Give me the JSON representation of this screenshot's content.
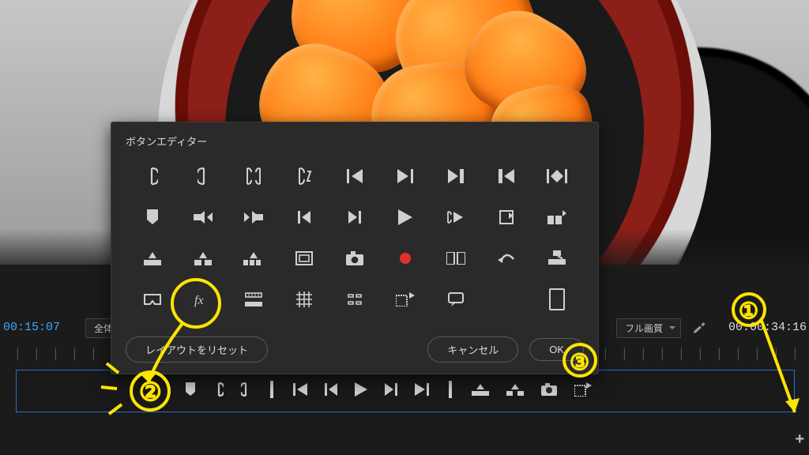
{
  "time": {
    "in": "00:15:07",
    "out": "00:00:34:16"
  },
  "viewer": {
    "fit_label": "全体",
    "quality_label": "フル画質"
  },
  "popover": {
    "title": "ボタンエディター",
    "buttons": {
      "reset": "レイアウトをリセット",
      "cancel": "キャンセル",
      "ok": "OK"
    },
    "grid": [
      [
        "mark-in",
        "mark-out",
        "in-out",
        "go-to",
        "go-to-in",
        "go-to-out",
        "go-to-next",
        "go-to-prev",
        "in-out-jump"
      ],
      [
        "insert",
        "next-edit",
        "prev-edit",
        "step-back",
        "step-fwd",
        "play",
        "play-in-out",
        "lift",
        "extract"
      ],
      [
        "export-frame",
        "export-frame2",
        "multi",
        "safe-margins",
        "camera",
        "record",
        "compare",
        "undo",
        "ripple"
      ],
      [
        "vr",
        "fx",
        "ruler",
        "grid",
        "crop",
        "add-marker",
        "comment",
        "",
        "safe-box"
      ]
    ]
  },
  "transport_bar": {
    "buttons": [
      "marker",
      "mark-in",
      "mark-out",
      "bar",
      "go-in",
      "step-back",
      "play",
      "step-fwd",
      "go-out",
      "bar",
      "lift",
      "extract",
      "camera",
      "export"
    ]
  },
  "annotations": {
    "1": "①",
    "2": "②",
    "3": "③"
  }
}
